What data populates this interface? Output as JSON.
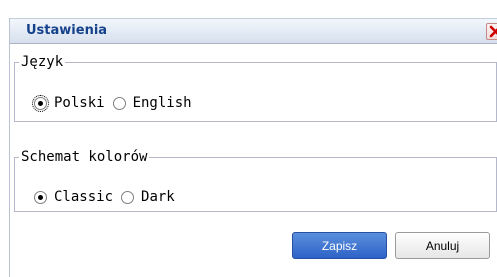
{
  "dialog": {
    "title": "Ustawienia",
    "close_icon": "close-icon",
    "colors": {
      "title_text": "#15428b",
      "close_x": "#cc0000",
      "primary_button": "#3a6fd0"
    }
  },
  "language": {
    "legend": "Język",
    "options": [
      {
        "label": "Polski",
        "checked": true
      },
      {
        "label": "English",
        "checked": false
      }
    ]
  },
  "color_scheme": {
    "legend": "Schemat kolorów",
    "options": [
      {
        "label": "Classic",
        "checked": true
      },
      {
        "label": "Dark",
        "checked": false
      }
    ]
  },
  "buttons": {
    "save": "Zapisz",
    "cancel": "Anuluj"
  }
}
